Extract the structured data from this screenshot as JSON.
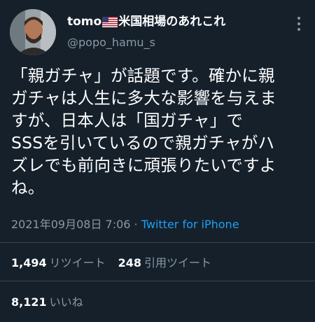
{
  "user": {
    "name_prefix": "tomo",
    "name_suffix": "米国相場のあれこれ",
    "flag_icon": "us-flag-icon",
    "handle": "@popo_hamu_s"
  },
  "tweet": {
    "text": "「親ガチャ」が話題です。確かに親\nガチャは人生に多大な影響を与えま\nすが、日本人は「国ガチャ」で\nSSSを引いているので親ガチャがハ\nズレでも前向きに頑張りたいですよ\nね。",
    "timestamp": "2021年09月08日 7:06",
    "separator": " · ",
    "source": "Twitter for iPhone"
  },
  "stats": {
    "retweets_count": "1,494",
    "retweets_label": "リツイート",
    "quotes_count": "248",
    "quotes_label": "引用ツイート",
    "likes_count": "8,121",
    "likes_label": "いいね"
  },
  "colors": {
    "background": "#15202b",
    "secondary_text": "#8899a6",
    "link": "#1da1f2",
    "divider": "#38444d"
  }
}
